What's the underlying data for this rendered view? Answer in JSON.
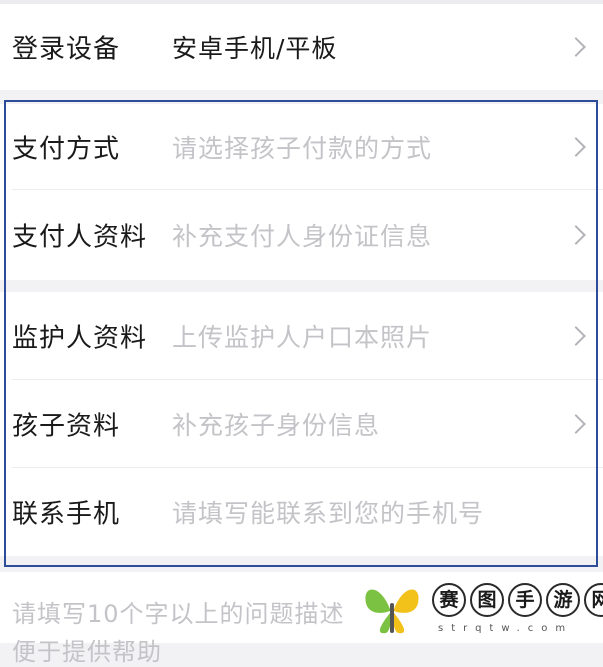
{
  "device_row": {
    "label": "登录设备",
    "value": "安卓手机/平板"
  },
  "payment_method_row": {
    "label": "支付方式",
    "placeholder": "请选择孩子付款的方式"
  },
  "payer_info_row": {
    "label": "支付人资料",
    "placeholder": "补充支付人身份证信息"
  },
  "guardian_info_row": {
    "label": "监护人资料",
    "placeholder": "上传监护人户口本照片"
  },
  "child_info_row": {
    "label": "孩子资料",
    "placeholder": "补充孩子身份信息"
  },
  "contact_phone_row": {
    "label": "联系手机",
    "placeholder": "请填写能联系到您的手机号"
  },
  "description": {
    "placeholder_line1": "请填写10个字以上的问题描述",
    "placeholder_line2": "便于提供帮助"
  },
  "watermark": {
    "chars": [
      "赛",
      "图",
      "手",
      "游",
      "网"
    ],
    "url": "strqtw.com"
  },
  "colors": {
    "frame": "#2d4d9a",
    "logo_green": "#7cc242",
    "logo_yellow": "#f3c21a"
  }
}
